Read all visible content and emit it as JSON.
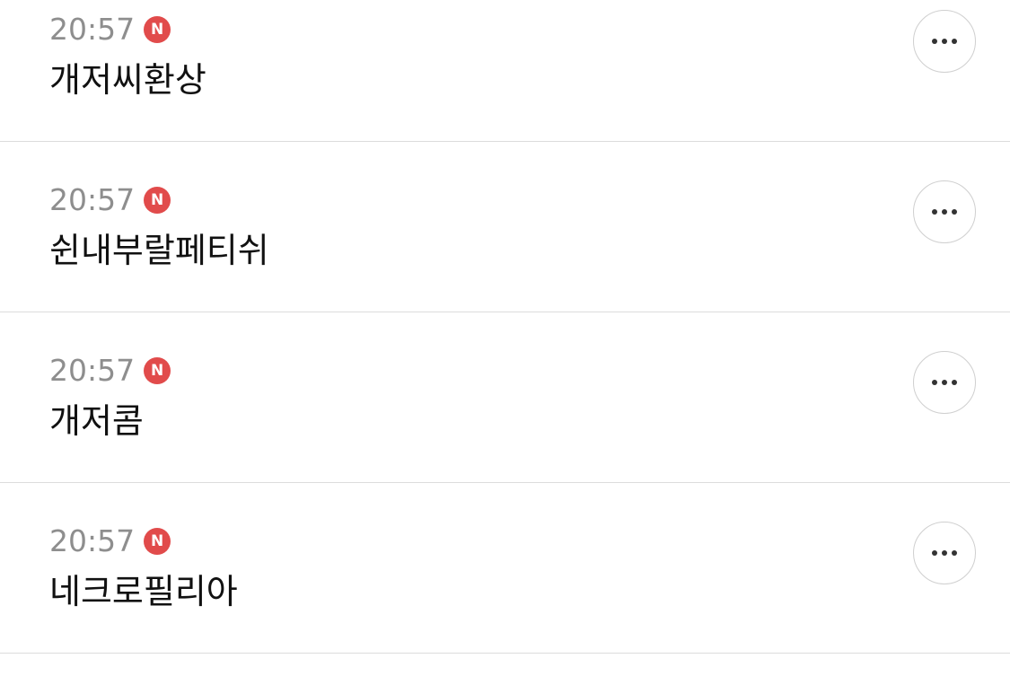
{
  "items": [
    {
      "time": "20:57",
      "badge": "N",
      "title": "개저씨환상"
    },
    {
      "time": "20:57",
      "badge": "N",
      "title": "쉰내부랄페티쉬"
    },
    {
      "time": "20:57",
      "badge": "N",
      "title": "개저콤"
    },
    {
      "time": "20:57",
      "badge": "N",
      "title": "네크로필리아"
    }
  ],
  "icons": {
    "more": "more-horizontal-icon"
  },
  "colors": {
    "badge": "#e14b4b",
    "time": "#8e8e8e",
    "title": "#111111",
    "divider": "#dcdcdc"
  }
}
